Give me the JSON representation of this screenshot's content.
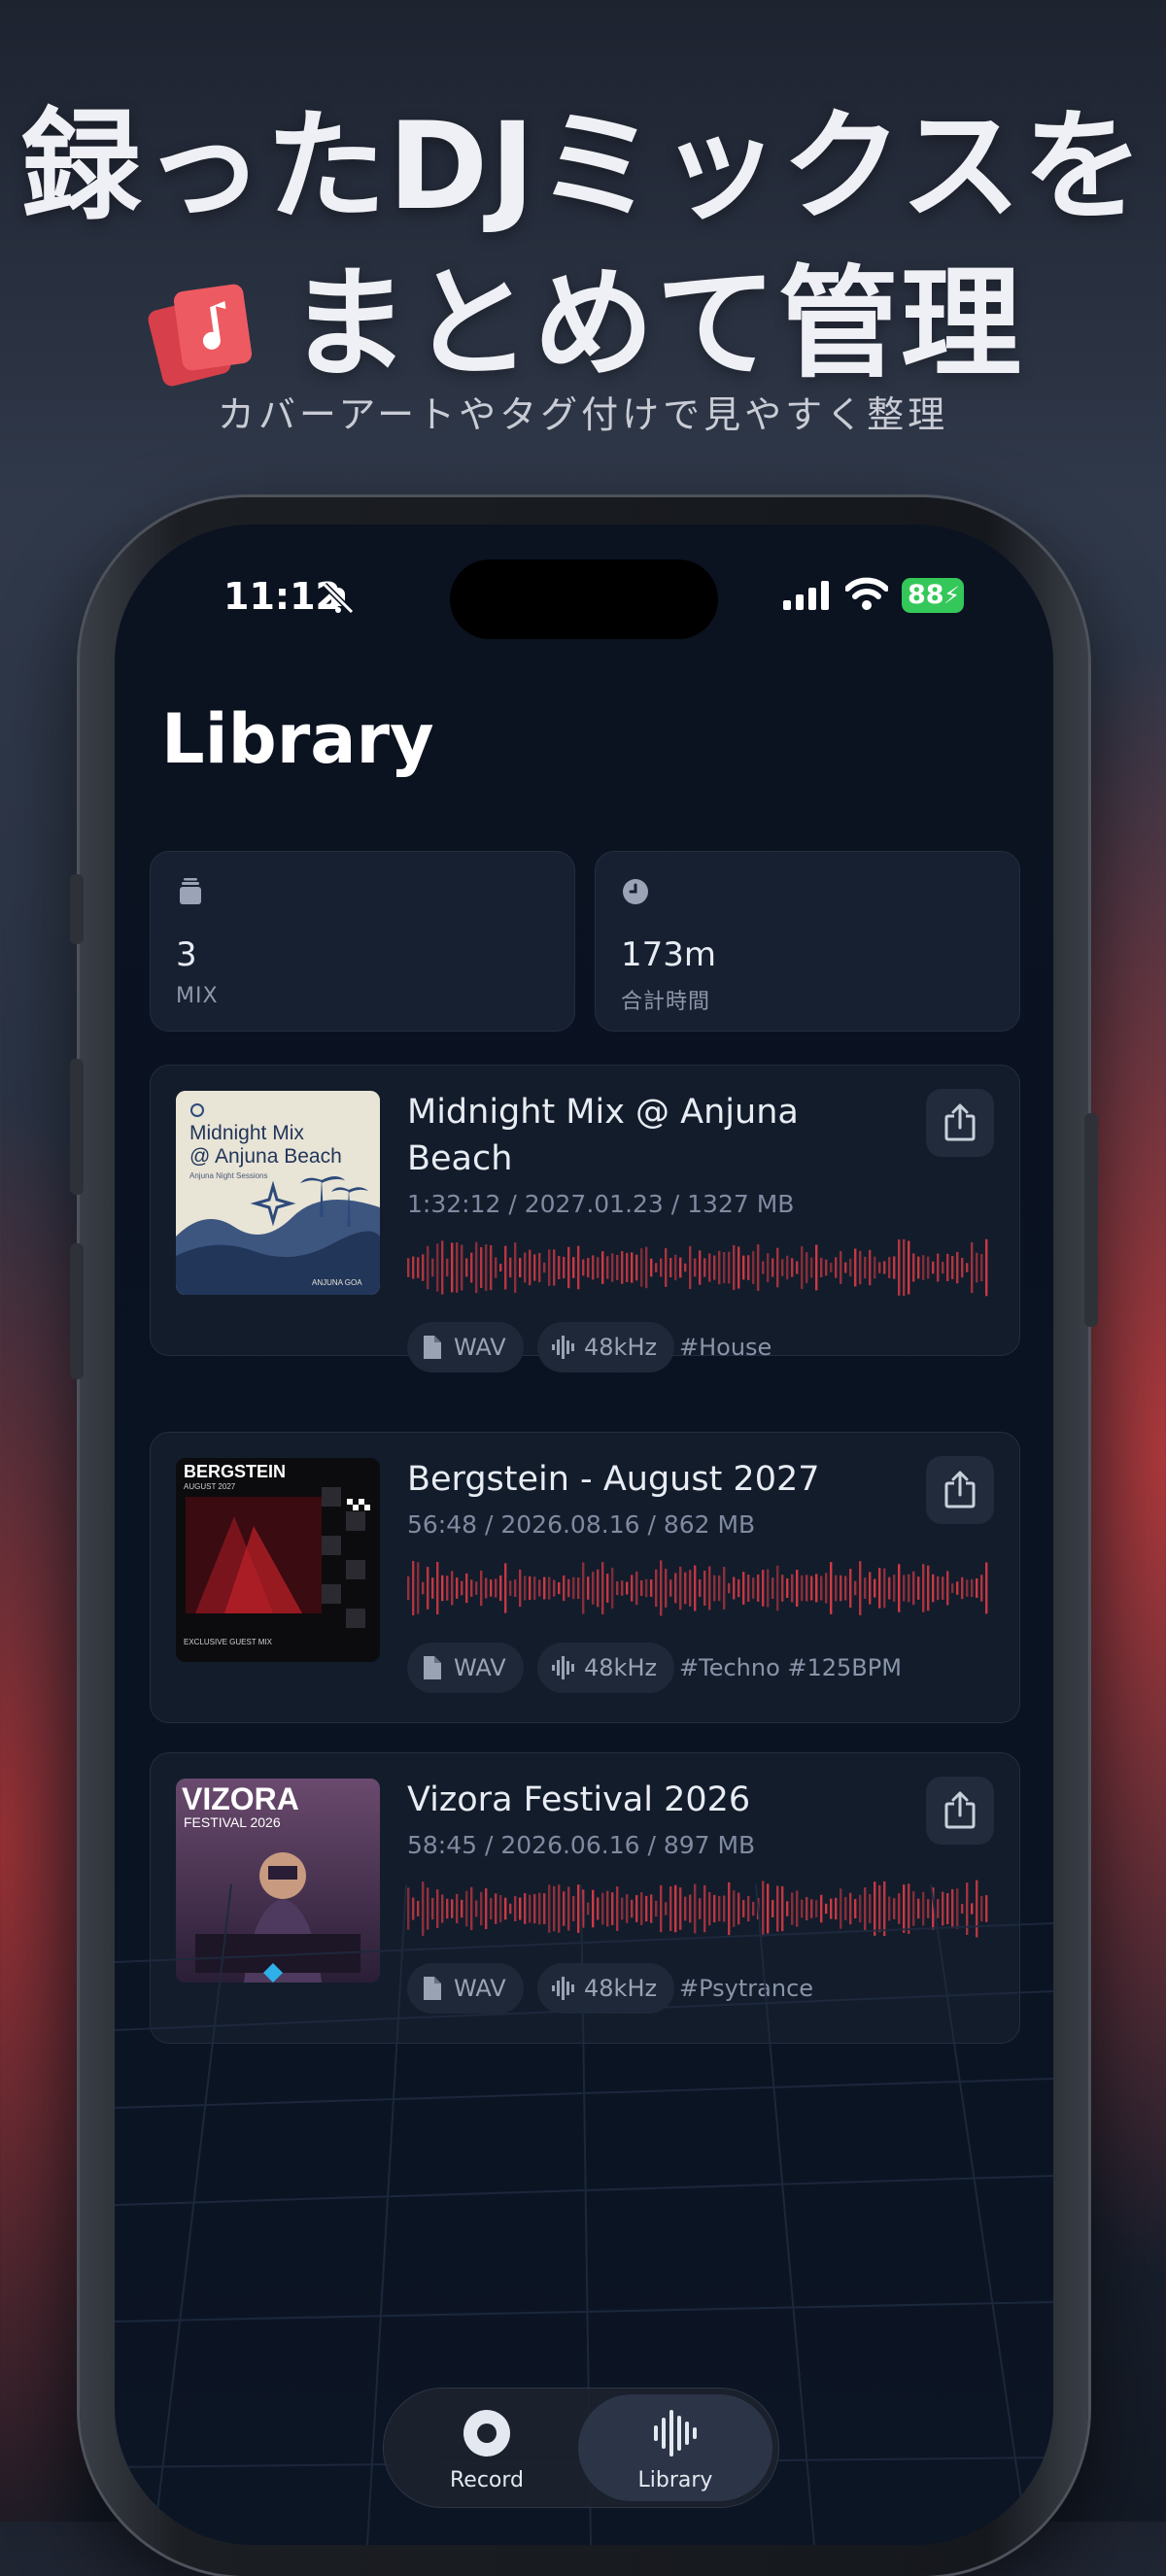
{
  "promo": {
    "headline_line1": "録ったDJミックスを",
    "headline_line2": "まとめて管理",
    "subtitle": "カバーアートやタグ付けで見やすく整理"
  },
  "status_bar": {
    "time": "11:12",
    "battery": "88",
    "icons": [
      "bell-slash-icon",
      "signal-icon",
      "wifi-icon",
      "battery-icon"
    ]
  },
  "screen": {
    "title": "Library"
  },
  "stats": [
    {
      "icon": "stack-icon",
      "value": "3",
      "label": "MIX"
    },
    {
      "icon": "clock-icon",
      "value": "173m",
      "label": "合計時間"
    }
  ],
  "mixes": [
    {
      "title": "Midnight Mix @ Anjuna Beach",
      "meta": "1:32:12 / 2027.01.23 / 1327 MB",
      "format": "WAV",
      "sample_rate": "48kHz",
      "tags": "#House",
      "cover": {
        "title": "Midnight Mix @ Anjuna Beach",
        "caption": "Anjuna Night Sessions",
        "footer": "ANJUNA GOA",
        "bg": "#e6e2d3",
        "accent": "#2d4a7a"
      }
    },
    {
      "title": "Bergstein - August 2027",
      "meta": "56:48 / 2026.08.16 / 862 MB",
      "format": "WAV",
      "sample_rate": "48kHz",
      "tags": "#Techno #125BPM",
      "cover": {
        "title": "BERGSTEIN",
        "caption": "AUGUST 2027",
        "footer": "EXCLUSIVE GUEST MIX",
        "bg": "#0c0c0e",
        "accent": "#c0212a"
      }
    },
    {
      "title": "Vizora Festival 2026",
      "meta": "58:45 / 2026.06.16 / 897 MB",
      "format": "WAV",
      "sample_rate": "48kHz",
      "tags": "#Psytrance",
      "cover": {
        "title": "VIZORA",
        "caption": "FESTIVAL 2026",
        "bg": "#3b2a4a",
        "accent": "#e24a6a"
      }
    }
  ],
  "tabbar": {
    "tabs": [
      {
        "label": "Record",
        "icon": "record-icon",
        "active": false
      },
      {
        "label": "Library",
        "icon": "waveform-icon",
        "active": true
      }
    ]
  },
  "colors": {
    "accent_red": "#d23a44",
    "card_bg": "#131c2b",
    "battery_green": "#34c759"
  }
}
